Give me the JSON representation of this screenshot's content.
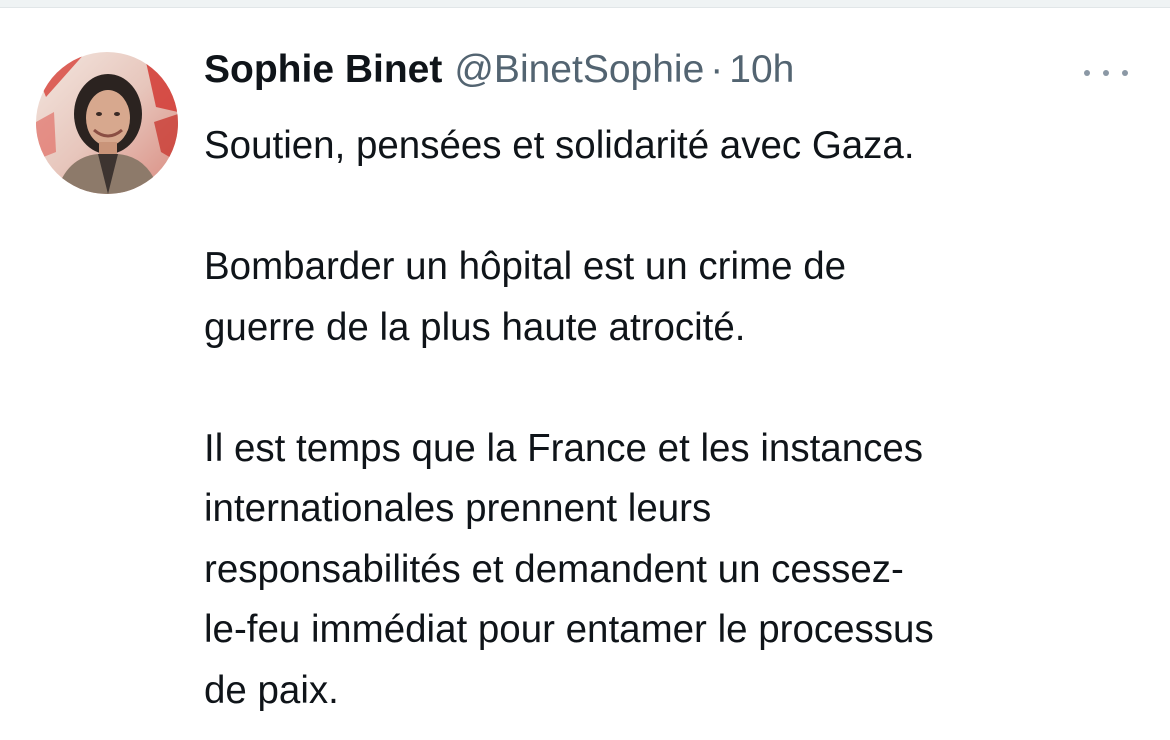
{
  "tweet": {
    "author": {
      "display_name": "Sophie Binet",
      "handle": "@BinetSophie",
      "separator": "·",
      "time": "10h"
    },
    "text": {
      "line1": "Soutien, pensées et solidarité avec Gaza.",
      "line2": "Bombarder un hôpital est un crime de",
      "line3": "guerre de la plus haute atrocité.",
      "line4": "Il est temps que la France et les instances",
      "line5": "internationales prennent leurs",
      "line6": "responsabilités et demandent un cessez-",
      "line7": "le-feu immédiat pour entamer le processus",
      "line8": "de paix."
    },
    "more_icon": "more-horizontal-icon"
  }
}
